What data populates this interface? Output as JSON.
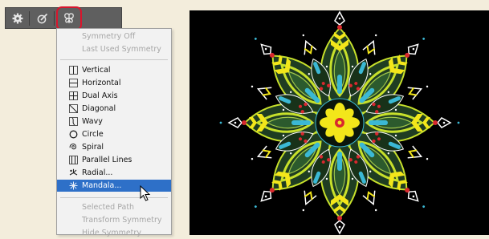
{
  "colors": {
    "accent_highlight": "#d8152c",
    "menu_selected": "#2e70c8",
    "canvas_background": "#000000",
    "mandala_lime": "#c7e02b",
    "mandala_yellow": "#f3e61a",
    "mandala_cyan": "#3bb8d4",
    "mandala_red": "#d8282e",
    "mandala_dark_green": "#1f3d22"
  },
  "toolbar": {
    "buttons": [
      {
        "icon": "gear-icon"
      },
      {
        "icon": "brush-icon"
      },
      {
        "icon": "butterfly-symmetry-icon",
        "highlighted": true
      }
    ]
  },
  "menu": {
    "items": [
      {
        "label": "Symmetry Off",
        "enabled": false
      },
      {
        "label": "Last Used Symmetry",
        "enabled": false
      },
      {
        "label": "Vertical",
        "icon": "vertical-icon",
        "enabled": true
      },
      {
        "label": "Horizontal",
        "icon": "horizontal-icon",
        "enabled": true
      },
      {
        "label": "Dual Axis",
        "icon": "dual-axis-icon",
        "enabled": true
      },
      {
        "label": "Diagonal",
        "icon": "diagonal-icon",
        "enabled": true
      },
      {
        "label": "Wavy",
        "icon": "wavy-icon",
        "enabled": true
      },
      {
        "label": "Circle",
        "icon": "circle-icon",
        "enabled": true
      },
      {
        "label": "Spiral",
        "icon": "spiral-icon",
        "enabled": true
      },
      {
        "label": "Parallel Lines",
        "icon": "parallel-lines-icon",
        "enabled": true
      },
      {
        "label": "Radial...",
        "icon": "radial-icon",
        "enabled": true
      },
      {
        "label": "Mandala...",
        "icon": "mandala-icon",
        "enabled": true,
        "selected": true
      },
      {
        "label": "Selected Path",
        "enabled": false
      },
      {
        "label": "Transform Symmetry",
        "enabled": false
      },
      {
        "label": "Hide Symmetry",
        "enabled": false
      }
    ]
  }
}
